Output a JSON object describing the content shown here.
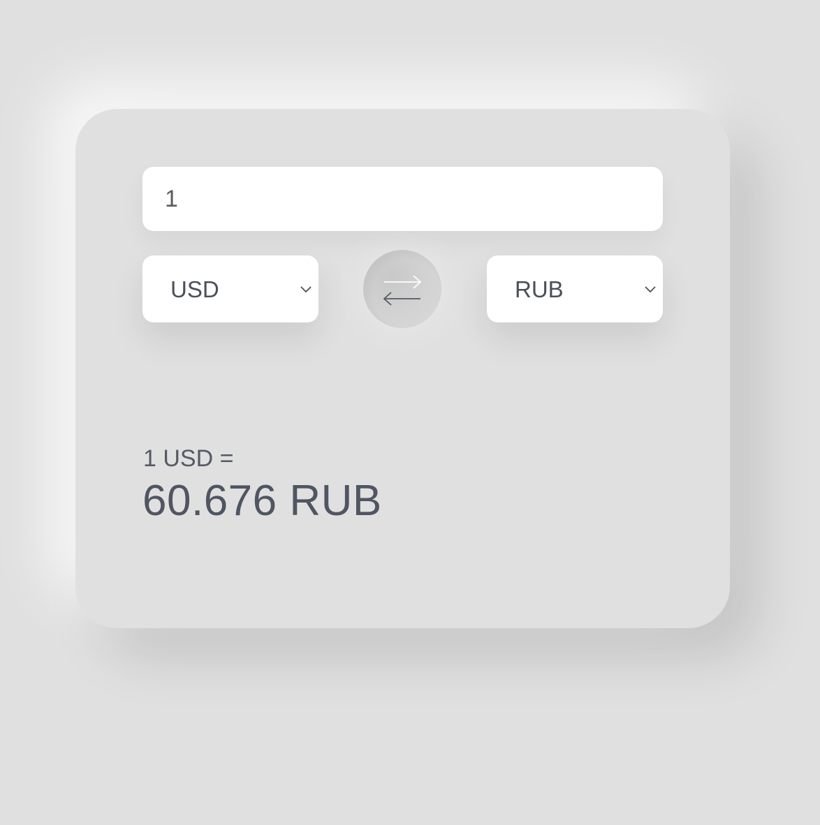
{
  "converter": {
    "amount_value": "1",
    "from_currency": "USD",
    "to_currency": "RUB",
    "swap_icon": "swap-arrows-icon",
    "dropdown_icon": "chevron-down-icon",
    "rate_label": "1 USD =",
    "rate_value": "60.676 RUB"
  },
  "colors": {
    "background": "#e0e0e0",
    "card": "#e0e0e0",
    "field": "#ffffff",
    "text": "#4f5561"
  }
}
